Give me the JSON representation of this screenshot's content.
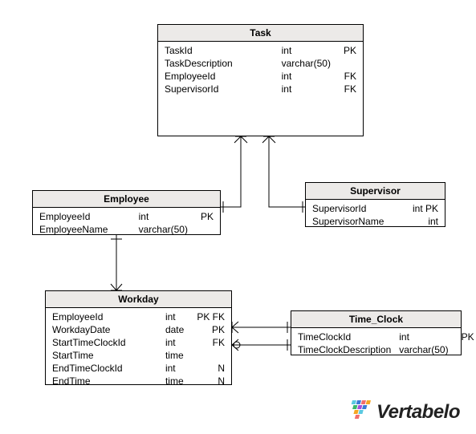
{
  "entities": {
    "task": {
      "title": "Task",
      "columns": [
        {
          "name": "TaskId",
          "type": "int",
          "key": "PK"
        },
        {
          "name": "TaskDescription",
          "type": "varchar(50)",
          "key": ""
        },
        {
          "name": "EmployeeId",
          "type": "int",
          "key": "FK"
        },
        {
          "name": "SupervisorId",
          "type": "int",
          "key": "FK"
        }
      ]
    },
    "employee": {
      "title": "Employee",
      "columns": [
        {
          "name": "EmployeeId",
          "type": "int",
          "key": "PK"
        },
        {
          "name": "EmployeeName",
          "type": "varchar(50)",
          "key": ""
        }
      ]
    },
    "supervisor": {
      "title": "Supervisor",
      "columns": [
        {
          "name": "SupervisorId",
          "type": "",
          "key": "int PK"
        },
        {
          "name": "SupervisorName",
          "type": "",
          "key": "int"
        }
      ]
    },
    "workday": {
      "title": "Workday",
      "columns": [
        {
          "name": "EmployeeId",
          "type": "int",
          "key": "PK FK"
        },
        {
          "name": "WorkdayDate",
          "type": "date",
          "key": "PK"
        },
        {
          "name": "StartTimeClockId",
          "type": "int",
          "key": "FK"
        },
        {
          "name": "StartTime",
          "type": "time",
          "key": ""
        },
        {
          "name": "EndTimeClockId",
          "type": "int",
          "key": "N"
        },
        {
          "name": "EndTime",
          "type": "time",
          "key": "N"
        }
      ]
    },
    "time_clock": {
      "title": "Time_Clock",
      "columns": [
        {
          "name": "TimeClockId",
          "type": "int",
          "key": "PK"
        },
        {
          "name": "TimeClockDescription",
          "type": "varchar(50)",
          "key": ""
        }
      ]
    }
  },
  "brand": "Vertabelo"
}
